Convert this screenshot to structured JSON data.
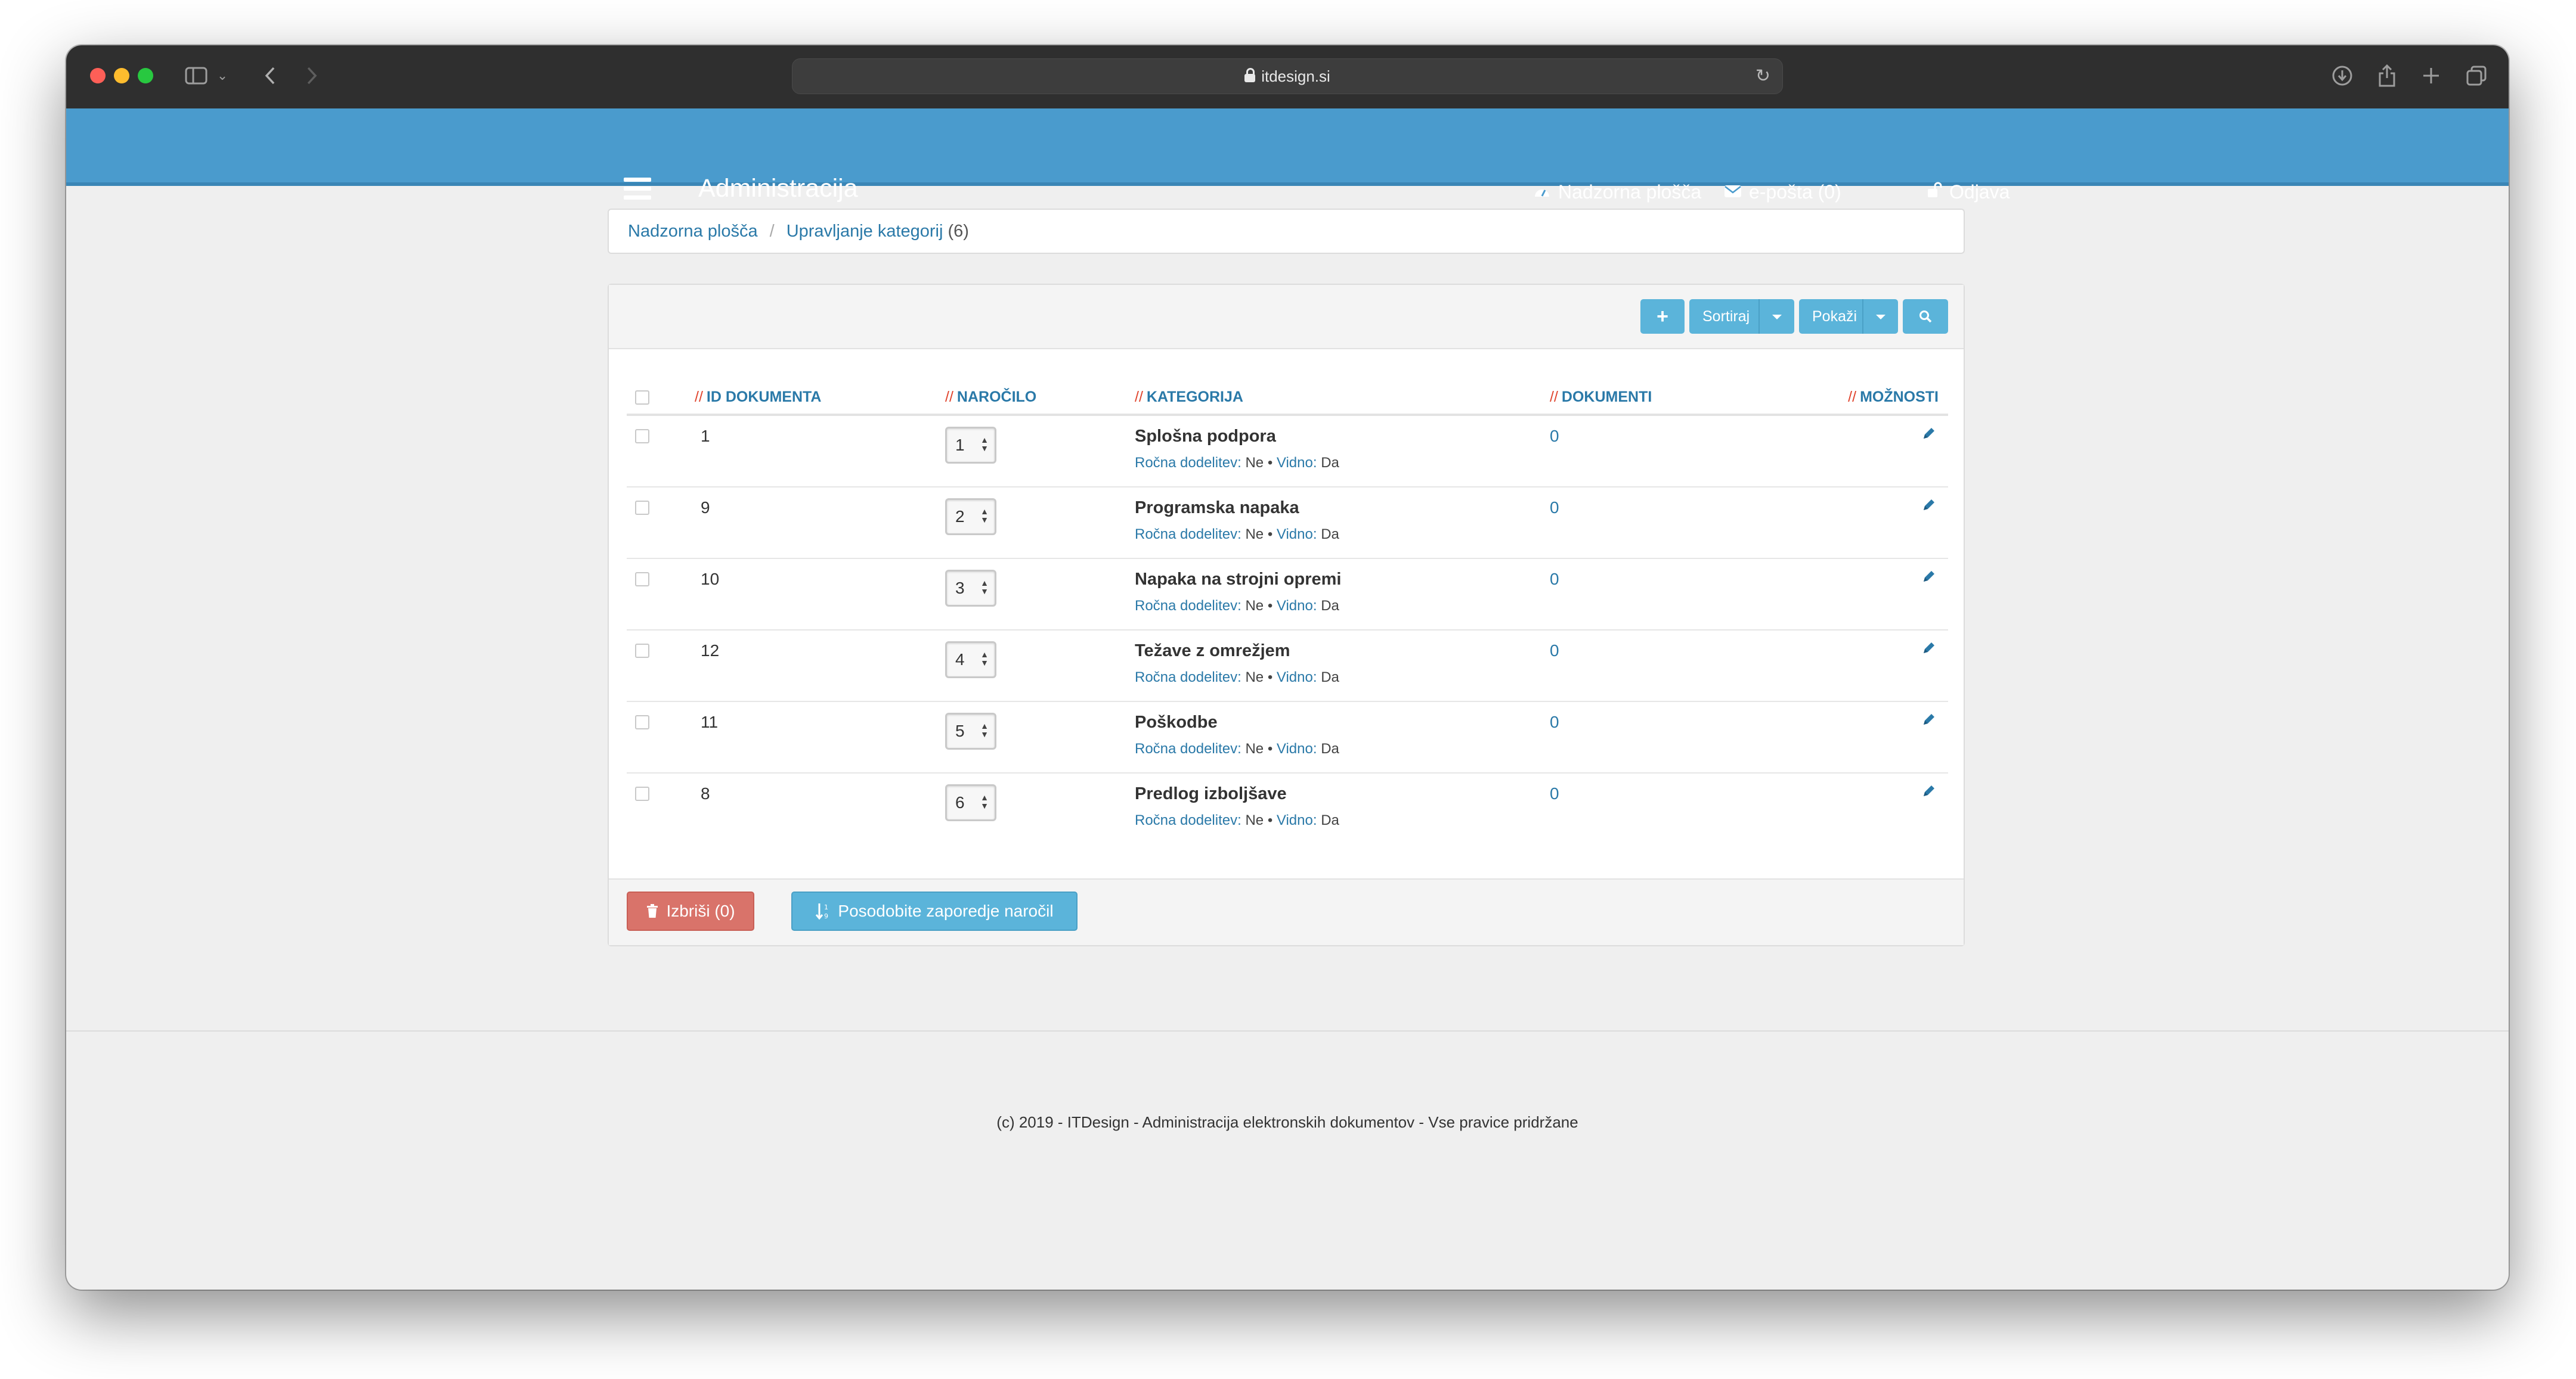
{
  "browser": {
    "url": "itdesign.si"
  },
  "header": {
    "title": "Administracija",
    "nav": [
      {
        "label": "Nadzorna plošča",
        "icon": "dashboard-icon"
      },
      {
        "label": "e-pošta (0)",
        "icon": "envelope-icon"
      },
      {
        "label": "Odjava",
        "icon": "unlock-icon"
      }
    ]
  },
  "breadcrumb": {
    "home": "Nadzorna plošča",
    "current": "Upravljanje kategorij",
    "count": "(6)"
  },
  "toolbar": {
    "add": "+",
    "sort": "Sortiraj",
    "show": "Pokaži"
  },
  "table": {
    "prefix": "//",
    "columns": {
      "id": "ID DOKUMENTA",
      "order": "NAROČILO",
      "category": "KATEGORIJA",
      "documents": "DOKUMENTI",
      "options": "MOŽNOSTI"
    },
    "meta_labels": {
      "manual": "Ročna dodelitev:",
      "visible": "Vidno:",
      "bullet": "•"
    },
    "rows": [
      {
        "id": "1",
        "order": "1",
        "name": "Splošna podpora",
        "manual": "Ne",
        "visible": "Da",
        "docs": "0"
      },
      {
        "id": "9",
        "order": "2",
        "name": "Programska napaka",
        "manual": "Ne",
        "visible": "Da",
        "docs": "0"
      },
      {
        "id": "10",
        "order": "3",
        "name": "Napaka na strojni opremi",
        "manual": "Ne",
        "visible": "Da",
        "docs": "0"
      },
      {
        "id": "12",
        "order": "4",
        "name": "Težave z omrežjem",
        "manual": "Ne",
        "visible": "Da",
        "docs": "0"
      },
      {
        "id": "11",
        "order": "5",
        "name": "Poškodbe",
        "manual": "Ne",
        "visible": "Da",
        "docs": "0"
      },
      {
        "id": "8",
        "order": "6",
        "name": "Predlog izboljšave",
        "manual": "Ne",
        "visible": "Da",
        "docs": "0"
      }
    ]
  },
  "footer_buttons": {
    "delete": "Izbriši (0)",
    "update": "Posodobite zaporedje naročil"
  },
  "footer": {
    "copyright": "(c) 2019 - ITDesign - Administracija elektronskih dokumentov - Vse pravice pridržane"
  },
  "colors": {
    "header": "#4a9bcd",
    "link": "#2a79a8",
    "accent_slash": "#e0442d",
    "button_primary": "#5bb4da",
    "button_danger": "#d9736a"
  }
}
